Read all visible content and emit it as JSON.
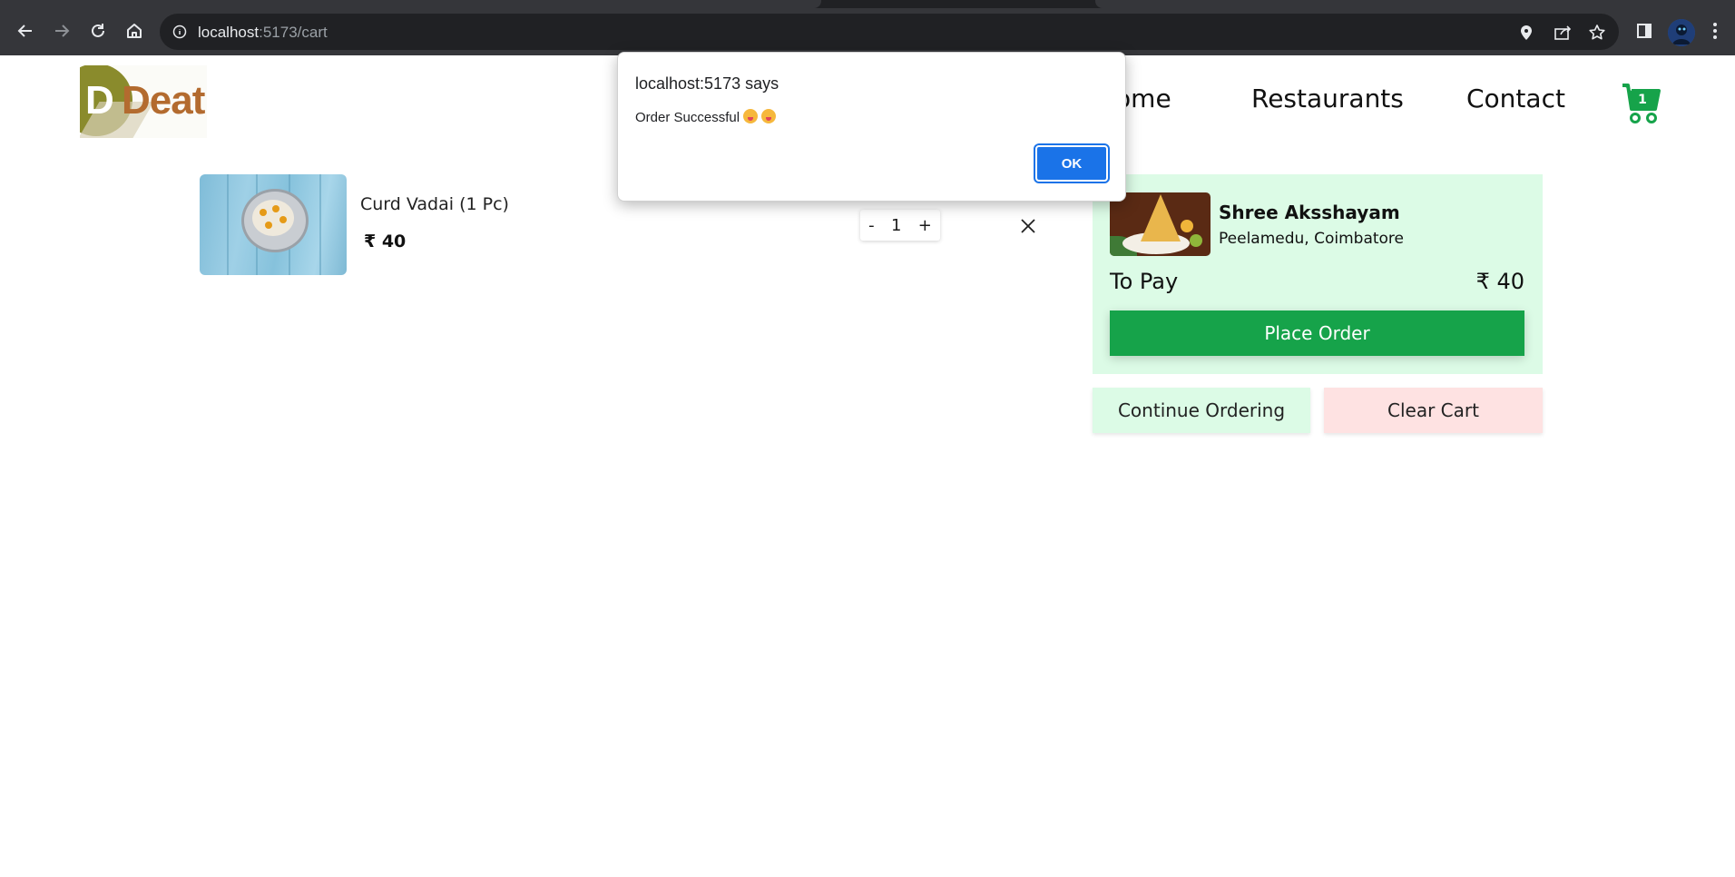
{
  "browser": {
    "url_host": "localhost",
    "url_rest": ":5173/cart"
  },
  "header": {
    "logo_mark": "D",
    "logo_text": "Deat",
    "nav": [
      "Home",
      "Restaurants",
      "Contact"
    ],
    "cart_count": "1"
  },
  "cart": {
    "item": {
      "name": "Curd Vadai (1 Pc)",
      "price": "₹ 40",
      "quantity": "1",
      "minus_label": "-",
      "plus_label": "+"
    }
  },
  "summary": {
    "restaurant_name": "Shree Aksshayam",
    "restaurant_location": "Peelamedu, Coimbatore",
    "to_pay_label": "To Pay",
    "to_pay_amount": "₹ 40",
    "place_order_label": "Place Order",
    "continue_label": "Continue Ordering",
    "clear_label": "Clear Cart"
  },
  "dialog": {
    "title": "localhost:5173 says",
    "message": "Order Successful",
    "ok_label": "OK"
  },
  "colors": {
    "accent_green": "#16a34a",
    "summary_bg": "#dcfbe6",
    "clear_bg": "#fee2e2",
    "dialog_ok": "#1a73e8"
  }
}
